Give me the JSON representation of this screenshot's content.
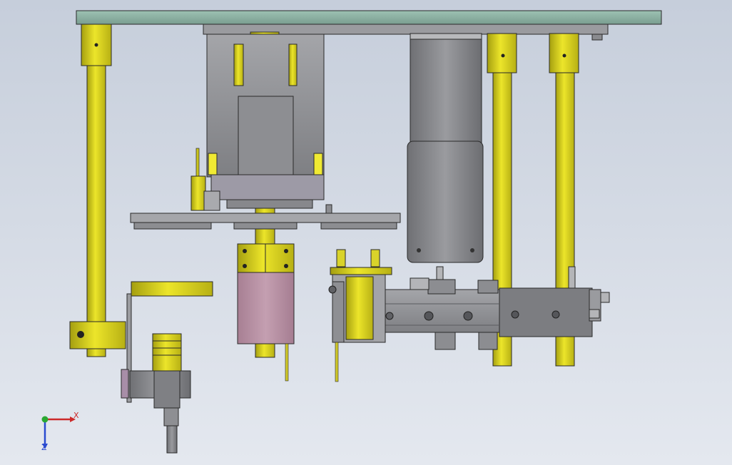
{
  "viewport": {
    "background_top": "#c6cedb",
    "background_bottom": "#e4e8ef"
  },
  "colors": {
    "yellow_part": "#dcd41a",
    "yellow_dark": "#8f8a12",
    "steel": "#8a8b8f",
    "steel_dark": "#5f6064",
    "plate_top": "#8fb5a6",
    "pink_block": "#b88ea3",
    "outline": "#2a2a2a"
  },
  "triad": {
    "x_label": "X",
    "z_label": "Z",
    "icon": "coordinate-triad-icon",
    "x_color": "#cc2a2a",
    "y_color": "#2aa832",
    "z_color": "#2a4bd0"
  }
}
